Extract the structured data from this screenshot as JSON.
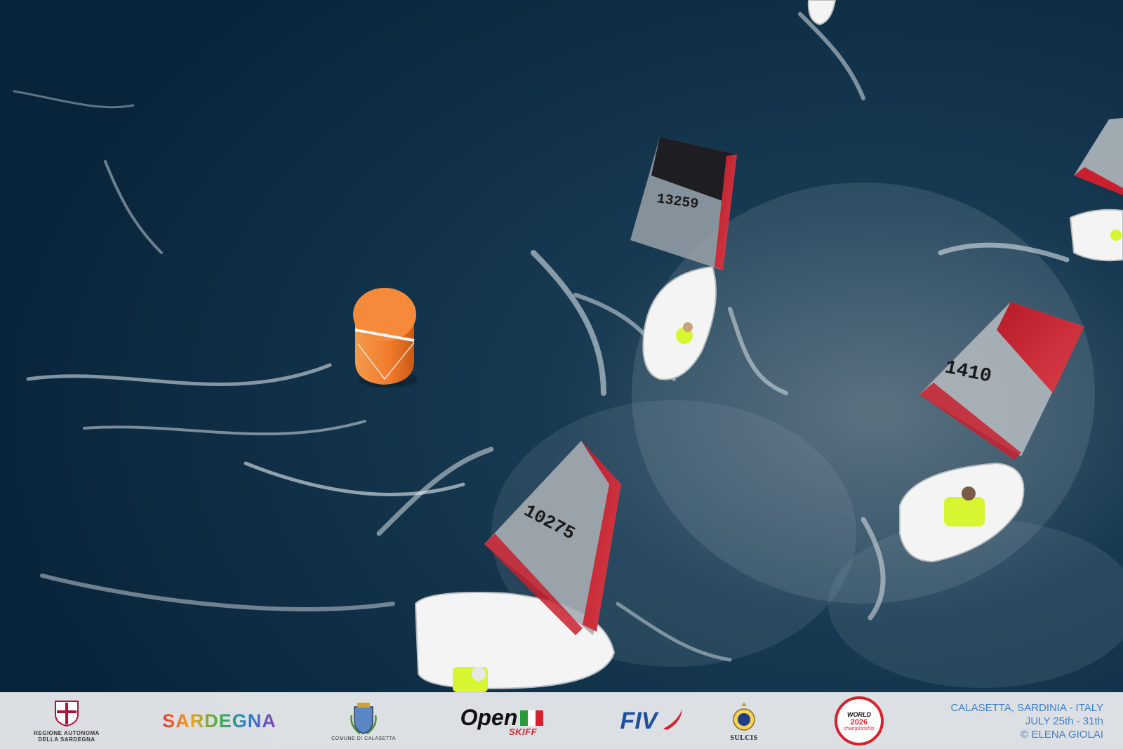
{
  "photo": {
    "sail_numbers": [
      "13259",
      "10275",
      "1410"
    ]
  },
  "sponsors": {
    "regione": {
      "line1": "REGIONE AUTONOMA",
      "line2": "DELLA SARDEGNA"
    },
    "sardegna": "SARDEGNA",
    "comune": "COMUNE DI CALASETTA",
    "openskiff": {
      "word": "Open",
      "sub": "SKIFF"
    },
    "fiv": "FIV",
    "sulcis": "SULCIS",
    "worlds": {
      "top": "WORLD",
      "year": "2026",
      "bottom": "championship"
    }
  },
  "credit": {
    "location": "CALASETTA, SARDINIA - ITALY",
    "dates": "JULY 25th - 31th",
    "photographer": "© ELENA GIOLAI"
  },
  "colors": {
    "sea": "#0c2c40",
    "sail_red": "#c8202e",
    "buoy_orange": "#f07a2a",
    "bib_yellow": "#d8f531",
    "credit_blue": "#3f7fc9"
  }
}
